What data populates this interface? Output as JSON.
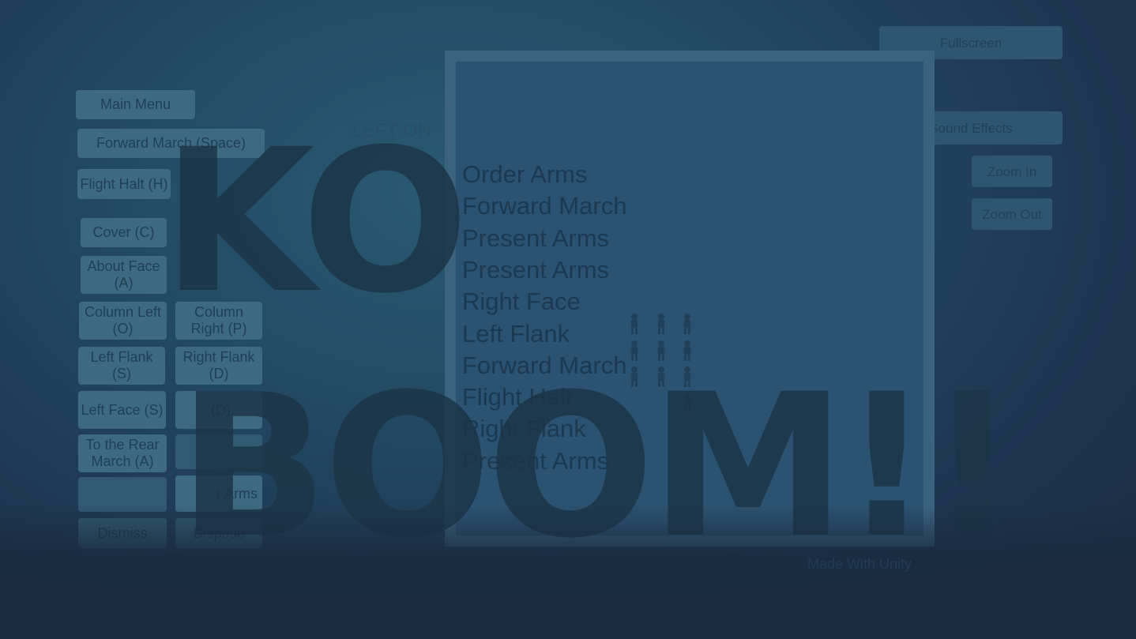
{
  "left_panel": {
    "main_menu": "Main Menu",
    "forward_march": "Forward March (Space)",
    "flight_halt": "Flight Halt (H)",
    "cover": "Cover (C)",
    "about_face": "About Face (A)",
    "column_left": "Column Left (O)",
    "column_right": "Column Right (P)",
    "left_flank": "Left Flank (S)",
    "right_flank": "Right Flank (D)",
    "left_face": "Left Face (S)",
    "right_face_partial": "(D)",
    "to_the_rear": "To the Rear March (A)",
    "order_arms_partial": "r Arms",
    "bottom_left_partial": "Dismiss",
    "bottom_right_partial": "Dispose"
  },
  "right_panel": {
    "top_button": "Fullscreen",
    "sound_effects": "Sound Effects",
    "zoom_in": "Zoom In",
    "zoom_out": "Zoom Out"
  },
  "game": {
    "caption_partial": "LEFT ON",
    "command_log": [
      "Order Arms",
      "Forward March",
      "Present Arms",
      "Present Arms",
      "Right Face",
      "Left Flank",
      "Forward March",
      "Flight Halt",
      "Right Flank",
      "Present Arms"
    ]
  },
  "logo": {
    "line1": "KO",
    "line2": "BOOM!!"
  },
  "footer": {
    "right_text": "Made With Unity"
  },
  "colors": {
    "button_bg": "#3d6981",
    "button_text": "#1f3f55",
    "frame": "#3b6380",
    "logo": "#1b3447"
  }
}
